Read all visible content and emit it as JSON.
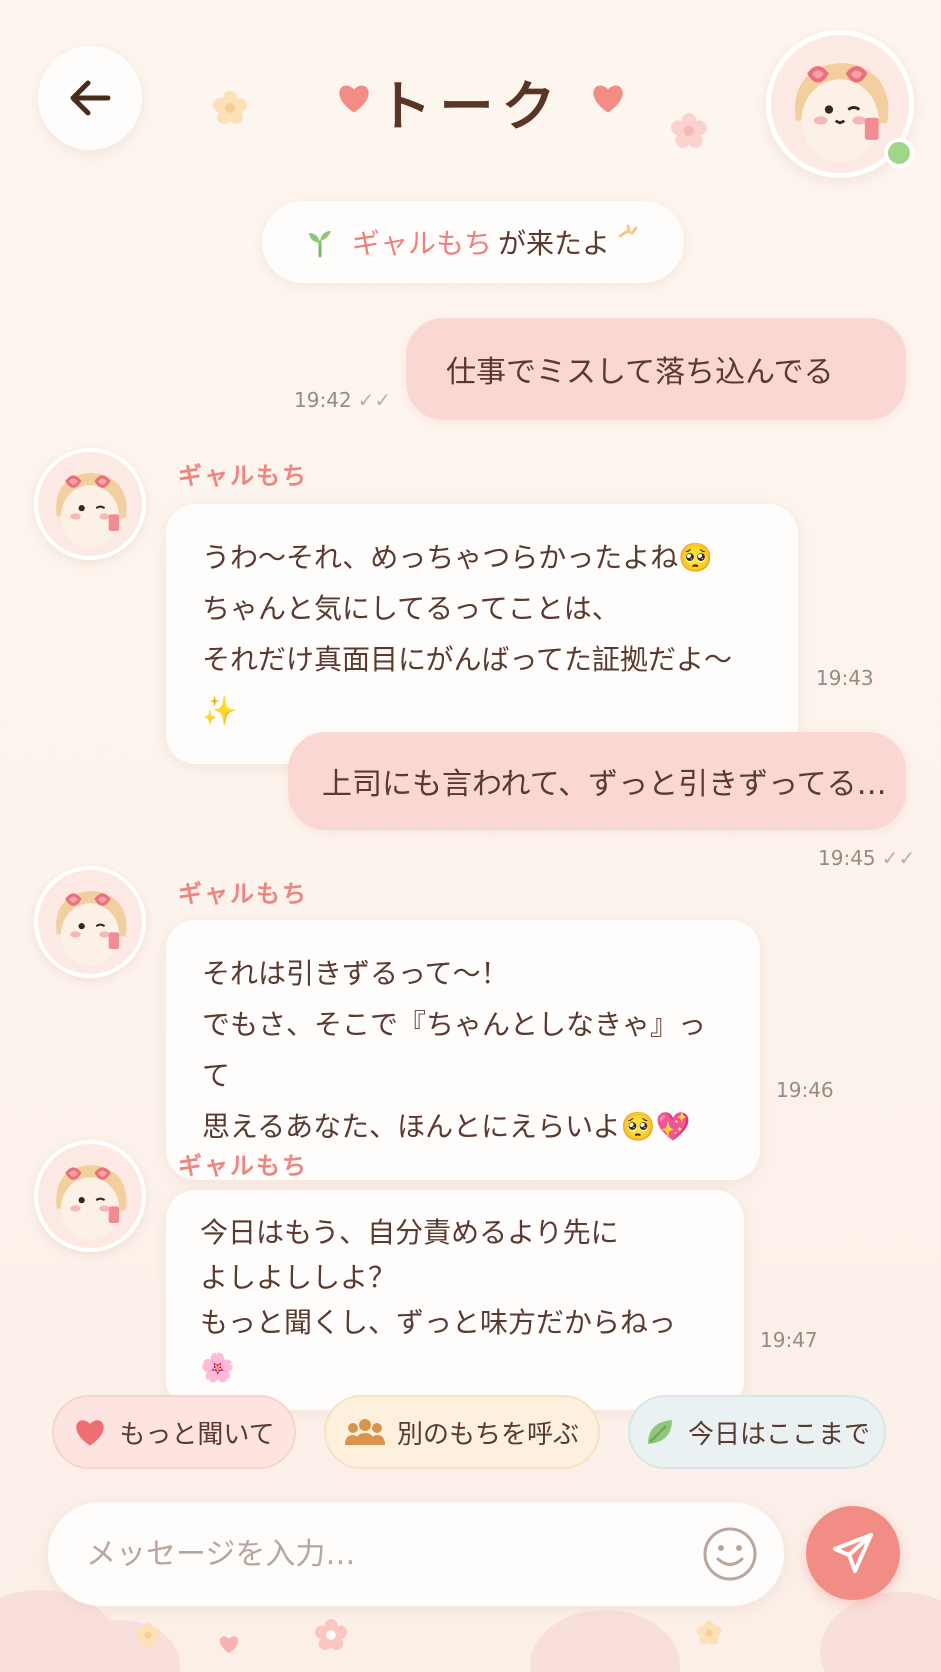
{
  "header": {
    "title": "トーク",
    "back_icon": "arrow-left-icon",
    "avatar_status": "online",
    "accent_color": "#f07f7b"
  },
  "system_notice": {
    "name": "ギャルもち",
    "text": "が来たよ"
  },
  "messages": [
    {
      "from": "me",
      "text": "仕事でミスして落ち込んでる",
      "time": "19:42"
    },
    {
      "from": "bot",
      "sender": "ギャルもち",
      "lines": [
        "うわ〜それ、めっちゃつらかったよね🥺",
        "ちゃんと気にしてるってことは、",
        "それだけ真面目にがんばってた証拠だよ〜✨"
      ],
      "time": "19:43"
    },
    {
      "from": "me",
      "text": "上司にも言われて、ずっと引きずってる…",
      "time": "19:45"
    },
    {
      "from": "bot",
      "sender": "ギャルもち",
      "lines": [
        "それは引きずるって〜！",
        "でもさ、そこで『ちゃんとしなきゃ』って",
        "思えるあなた、ほんとにえらいよ🥺💖"
      ],
      "time": "19:46"
    },
    {
      "from": "bot",
      "sender": "ギャルもち",
      "lines": [
        "今日はもう、自分責めるより先に",
        "よしよししよ？",
        "もっと聞くし、ずっと味方だからねっ🌸"
      ],
      "time": "19:47"
    }
  ],
  "quick_replies": [
    {
      "label": "もっと聞いて",
      "icon": "heart-icon"
    },
    {
      "label": "別のもちを呼ぶ",
      "icon": "group-icon"
    },
    {
      "label": "今日はここまで",
      "icon": "leaf-icon"
    }
  ],
  "composer": {
    "placeholder": "メッセージを入力…",
    "emoji_icon": "smiley-icon",
    "send_icon": "send-icon"
  }
}
